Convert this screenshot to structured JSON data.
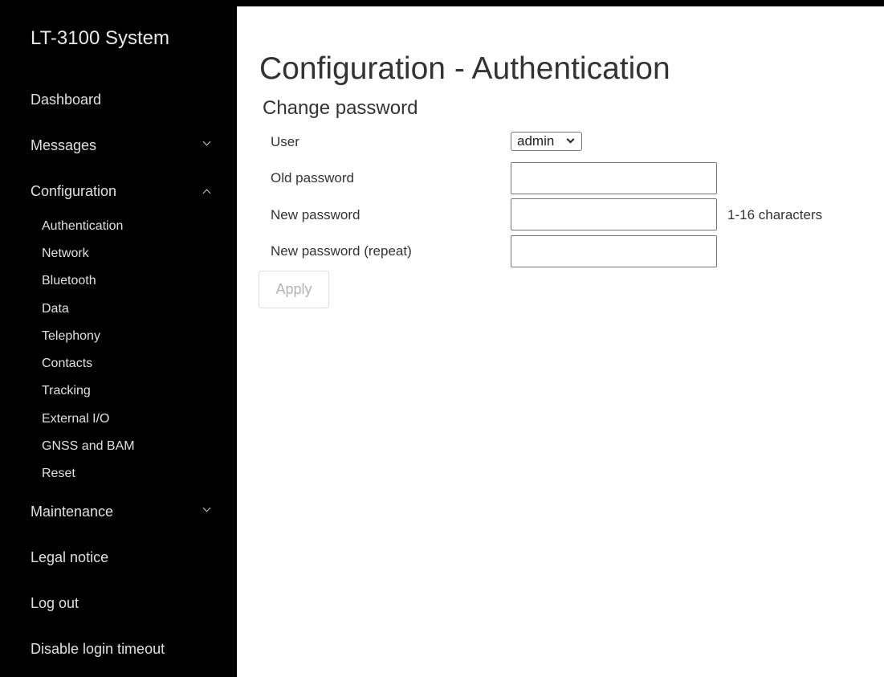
{
  "sidebar": {
    "brand": "LT-3100 System",
    "items": {
      "dashboard": "Dashboard",
      "messages": "Messages",
      "configuration": "Configuration",
      "maintenance": "Maintenance",
      "legal_notice": "Legal notice",
      "log_out": "Log out",
      "disable_login_timeout": "Disable login timeout"
    },
    "configuration_subitems": [
      "Authentication",
      "Network",
      "Bluetooth",
      "Data",
      "Telephony",
      "Contacts",
      "Tracking",
      "External I/O",
      "GNSS and BAM",
      "Reset"
    ],
    "active_subitem": "Authentication"
  },
  "main": {
    "title": "Configuration - Authentication",
    "section_title": "Change password",
    "form": {
      "user_label": "User",
      "user_value": "admin",
      "old_password_label": "Old password",
      "old_password_value": "",
      "new_password_label": "New password",
      "new_password_value": "",
      "new_password_hint": "1-16 characters",
      "new_password_repeat_label": "New password (repeat)",
      "new_password_repeat_value": "",
      "apply_label": "Apply",
      "apply_disabled": true
    }
  },
  "icons": {
    "collapsed": "chevron-down-icon",
    "expanded": "chevron-up-icon",
    "select": "select-arrow-icon"
  },
  "colors": {
    "sidebar_background": "#000000",
    "sidebar_text": "#e0e0e0",
    "body_text": "#333333",
    "disabled_text": "#b3b3b3"
  }
}
